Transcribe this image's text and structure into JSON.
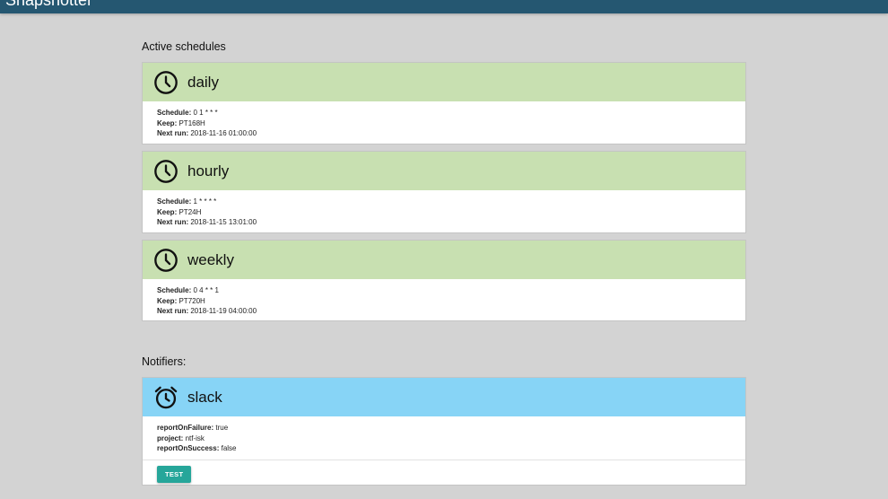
{
  "app": {
    "title": "Snapshotter"
  },
  "colors": {
    "topbar": "#255771",
    "schedule_header": "#c8e0b1",
    "notifier_header": "#87d4f6",
    "button": "#26a69a"
  },
  "schedules": {
    "heading": "Active schedules",
    "icon": "clock-icon",
    "items": [
      {
        "name": "daily",
        "schedule_label": "Schedule:",
        "schedule": "0 1 * * *",
        "keep_label": "Keep:",
        "keep": "PT168H",
        "next_label": "Next run:",
        "next": "2018-11-16 01:00:00"
      },
      {
        "name": "hourly",
        "schedule_label": "Schedule:",
        "schedule": "1 * * * *",
        "keep_label": "Keep:",
        "keep": "PT24H",
        "next_label": "Next run:",
        "next": "2018-11-15 13:01:00"
      },
      {
        "name": "weekly",
        "schedule_label": "Schedule:",
        "schedule": "0 4 * * 1",
        "keep_label": "Keep:",
        "keep": "PT720H",
        "next_label": "Next run:",
        "next": "2018-11-19 04:00:00"
      }
    ]
  },
  "notifiers": {
    "heading": "Notifiers:",
    "icon": "alarm-clock-icon",
    "items": [
      {
        "name": "slack",
        "props": [
          {
            "key": "reportOnFailure:",
            "value": "true"
          },
          {
            "key": "project:",
            "value": "ntf-isk"
          },
          {
            "key": "reportOnSuccess:",
            "value": "false"
          }
        ],
        "test_label": "TEST"
      }
    ]
  }
}
